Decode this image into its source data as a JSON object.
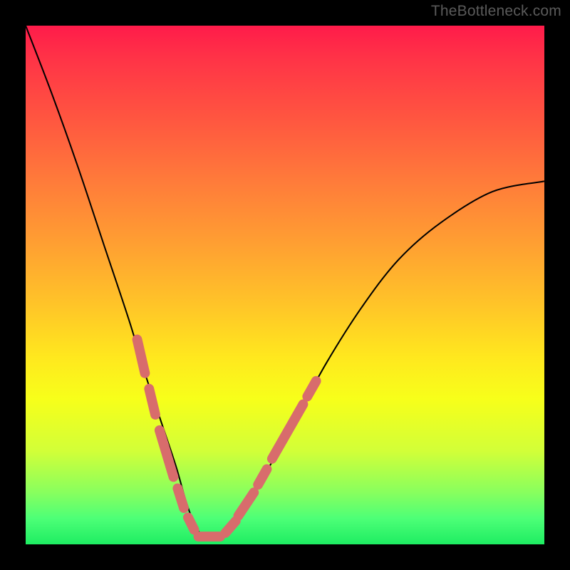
{
  "watermark": "TheBottleneck.com",
  "colors": {
    "background": "#000000",
    "gradient_top": "#ff1b4a",
    "gradient_bottom": "#1eed62",
    "curve": "#000000",
    "markers": "#d86c6c"
  },
  "chart_data": {
    "type": "line",
    "title": "",
    "xlabel": "",
    "ylabel": "",
    "xlim": [
      0,
      100
    ],
    "ylim": [
      0,
      100
    ],
    "legend": false,
    "grid": false,
    "series": [
      {
        "name": "bottleneck-curve",
        "x": [
          0,
          5,
          10,
          15,
          20,
          23,
          26,
          29,
          31,
          33,
          35,
          37,
          40,
          43,
          47,
          52,
          58,
          65,
          72,
          80,
          90,
          100
        ],
        "y": [
          100,
          87,
          73,
          58,
          43,
          33,
          24,
          15,
          8,
          3,
          1,
          1,
          3,
          8,
          15,
          24,
          35,
          46,
          55,
          62,
          68,
          70
        ]
      }
    ],
    "markers": {
      "name": "highlighted-segments",
      "style": "thick-dash",
      "color": "#d86c6c",
      "segments": [
        {
          "x": [
            21.5,
            23.0
          ],
          "y": [
            39.5,
            33.0
          ]
        },
        {
          "x": [
            23.8,
            25.0
          ],
          "y": [
            30.0,
            25.0
          ]
        },
        {
          "x": [
            25.8,
            28.5
          ],
          "y": [
            22.0,
            13.0
          ]
        },
        {
          "x": [
            29.3,
            30.5
          ],
          "y": [
            10.8,
            7.0
          ]
        },
        {
          "x": [
            31.3,
            32.5
          ],
          "y": [
            5.2,
            2.8
          ]
        },
        {
          "x": [
            33.3,
            37.5
          ],
          "y": [
            1.5,
            1.5
          ]
        },
        {
          "x": [
            38.5,
            40.5
          ],
          "y": [
            2.2,
            4.5
          ]
        },
        {
          "x": [
            41.0,
            44.0
          ],
          "y": [
            5.5,
            10.0
          ]
        },
        {
          "x": [
            44.8,
            46.5
          ],
          "y": [
            11.5,
            14.5
          ]
        },
        {
          "x": [
            47.5,
            53.5
          ],
          "y": [
            16.5,
            27.0
          ]
        },
        {
          "x": [
            54.3,
            56.0
          ],
          "y": [
            28.5,
            31.5
          ]
        }
      ]
    }
  }
}
